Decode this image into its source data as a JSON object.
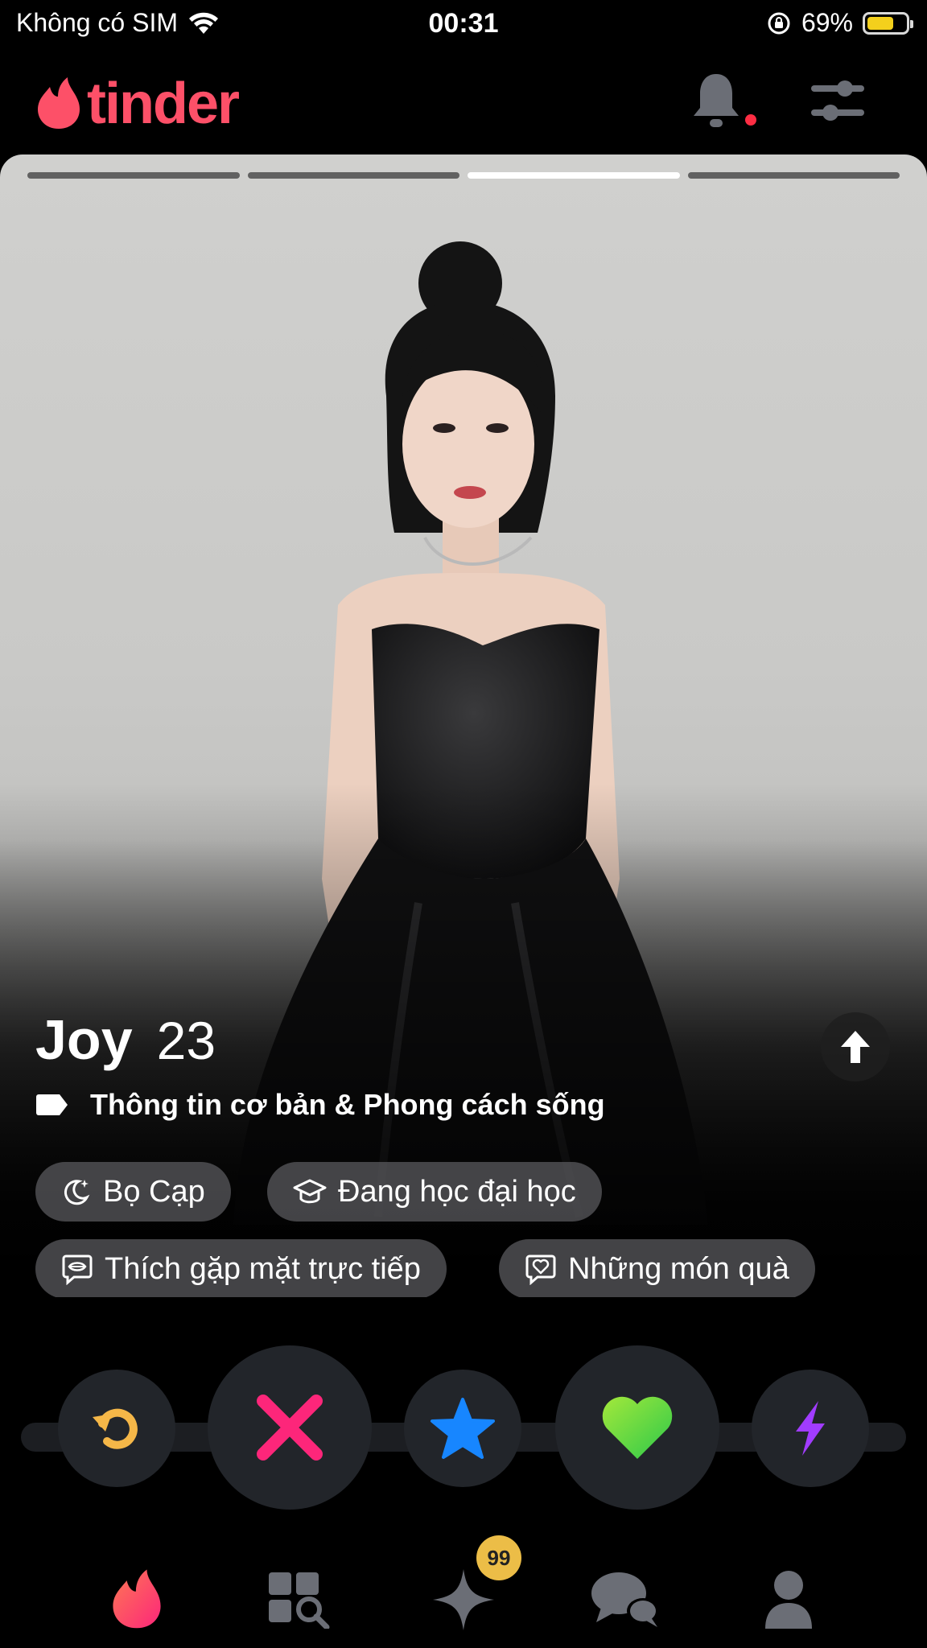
{
  "status_bar": {
    "carrier": "Không có SIM",
    "time": "00:31",
    "battery_percent": "69%",
    "battery_level": 0.69,
    "icons": [
      "wifi-icon",
      "orientation-lock-icon",
      "battery-icon"
    ]
  },
  "header": {
    "logo_text": "tinder",
    "brand_color": "#fd5068",
    "notification_dot": true
  },
  "card": {
    "photo_count": 4,
    "active_photo_index": 2,
    "name": "Joy",
    "age": "23",
    "info_label": "Thông tin cơ bản & Phong cách sống",
    "chips": [
      {
        "icon": "moon-star-icon",
        "label": "Bọ Cạp"
      },
      {
        "icon": "graduation-cap-icon",
        "label": "Đang học đại học"
      },
      {
        "icon": "chat-lips-icon",
        "label": "Thích gặp mặt trực tiếp"
      },
      {
        "icon": "chat-heart-icon",
        "label": "Những món quà"
      }
    ]
  },
  "actions": [
    {
      "name": "rewind",
      "icon": "rewind-icon",
      "color": "#f5b748"
    },
    {
      "name": "nope",
      "icon": "close-icon",
      "color": "#fd267a"
    },
    {
      "name": "super-like",
      "icon": "star-icon",
      "color": "#1786ff"
    },
    {
      "name": "like",
      "icon": "heart-icon",
      "color": "#6cd33f"
    },
    {
      "name": "boost",
      "icon": "bolt-icon",
      "color": "#a13cff"
    }
  ],
  "tabs": [
    {
      "name": "discover",
      "icon": "flame-icon",
      "active": true
    },
    {
      "name": "explore",
      "icon": "explore-grid-icon"
    },
    {
      "name": "likes",
      "icon": "sparkle-icon",
      "badge": "99"
    },
    {
      "name": "messages",
      "icon": "chat-bubbles-icon"
    },
    {
      "name": "profile",
      "icon": "person-icon"
    }
  ]
}
